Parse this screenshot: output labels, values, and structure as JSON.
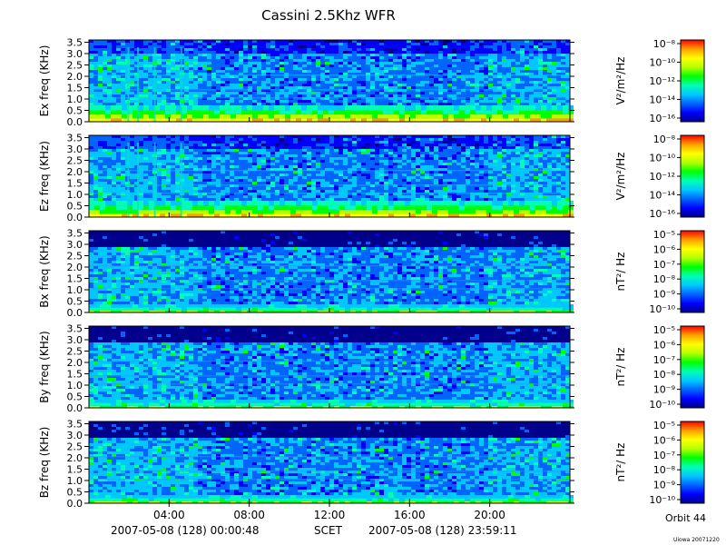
{
  "title": "Cassini 2.5Khz WFR",
  "footer": {
    "start": "2007-05-08 (128) 00:00:48",
    "frame": "SCET",
    "end": "2007-05-08 (128) 23:59:11",
    "orbit": "Orbit 44",
    "credit": "Uiowa 20071220"
  },
  "colormap": [
    "#00008c",
    "#0000ff",
    "#0064ff",
    "#00c8ff",
    "#00ffb4",
    "#00ff00",
    "#b4ff00",
    "#ffff00",
    "#ffa000",
    "#ff0000"
  ],
  "chart_data": [
    {
      "type": "heatmap",
      "name": "Ex",
      "ylabel": "Ex freq (KHz)",
      "yticks": [
        "0.0",
        "0.5",
        "1.0",
        "1.5",
        "2.0",
        "2.5",
        "3.0",
        "3.5"
      ],
      "ylim": [
        0,
        3.6
      ],
      "xticks": [
        "04:00",
        "08:00",
        "12:00",
        "16:00",
        "20:00"
      ],
      "xlim": [
        "00:00:48",
        "23:59:11"
      ],
      "colorbar": {
        "unit_label": "V²/m²/Hz",
        "ticks": [
          "10⁻⁸",
          "10⁻¹⁰",
          "10⁻¹²",
          "10⁻¹⁴",
          "10⁻¹⁶"
        ]
      }
    },
    {
      "type": "heatmap",
      "name": "Ez",
      "ylabel": "Ez freq (KHz)",
      "yticks": [
        "0.0",
        "0.5",
        "1.0",
        "1.5",
        "2.0",
        "2.5",
        "3.0",
        "3.5"
      ],
      "ylim": [
        0,
        3.6
      ],
      "xticks": [
        "04:00",
        "08:00",
        "12:00",
        "16:00",
        "20:00"
      ],
      "xlim": [
        "00:00:48",
        "23:59:11"
      ],
      "colorbar": {
        "unit_label": "V²/m²/Hz",
        "ticks": [
          "10⁻⁸",
          "10⁻¹⁰",
          "10⁻¹²",
          "10⁻¹⁴",
          "10⁻¹⁶"
        ]
      }
    },
    {
      "type": "heatmap",
      "name": "Bx",
      "ylabel": "Bx freq (KHz)",
      "yticks": [
        "0.0",
        "0.5",
        "1.0",
        "1.5",
        "2.0",
        "2.5",
        "3.0",
        "3.5"
      ],
      "ylim": [
        0,
        3.6
      ],
      "xticks": [
        "04:00",
        "08:00",
        "12:00",
        "16:00",
        "20:00"
      ],
      "xlim": [
        "00:00:48",
        "23:59:11"
      ],
      "colorbar": {
        "unit_label": "nT²/ Hz",
        "ticks": [
          "10⁻⁵",
          "10⁻⁶",
          "10⁻⁷",
          "10⁻⁸",
          "10⁻⁹",
          "10⁻¹⁰"
        ]
      }
    },
    {
      "type": "heatmap",
      "name": "By",
      "ylabel": "By freq (KHz)",
      "yticks": [
        "0.0",
        "0.5",
        "1.0",
        "1.5",
        "2.0",
        "2.5",
        "3.0",
        "3.5"
      ],
      "ylim": [
        0,
        3.6
      ],
      "xticks": [
        "04:00",
        "08:00",
        "12:00",
        "16:00",
        "20:00"
      ],
      "xlim": [
        "00:00:48",
        "23:59:11"
      ],
      "colorbar": {
        "unit_label": "nT²/ Hz",
        "ticks": [
          "10⁻⁵",
          "10⁻⁶",
          "10⁻⁷",
          "10⁻⁸",
          "10⁻⁹",
          "10⁻¹⁰"
        ]
      }
    },
    {
      "type": "heatmap",
      "name": "Bz",
      "ylabel": "Bz freq (KHz)",
      "yticks": [
        "0.0",
        "0.5",
        "1.0",
        "1.5",
        "2.0",
        "2.5",
        "3.0",
        "3.5"
      ],
      "ylim": [
        0,
        3.6
      ],
      "xticks": [
        "04:00",
        "08:00",
        "12:00",
        "16:00",
        "20:00"
      ],
      "xlim": [
        "00:00:48",
        "23:59:11"
      ],
      "colorbar": {
        "unit_label": "nT²/ Hz",
        "ticks": [
          "10⁻⁵",
          "10⁻⁶",
          "10⁻⁷",
          "10⁻⁸",
          "10⁻⁹",
          "10⁻¹⁰"
        ]
      }
    }
  ]
}
